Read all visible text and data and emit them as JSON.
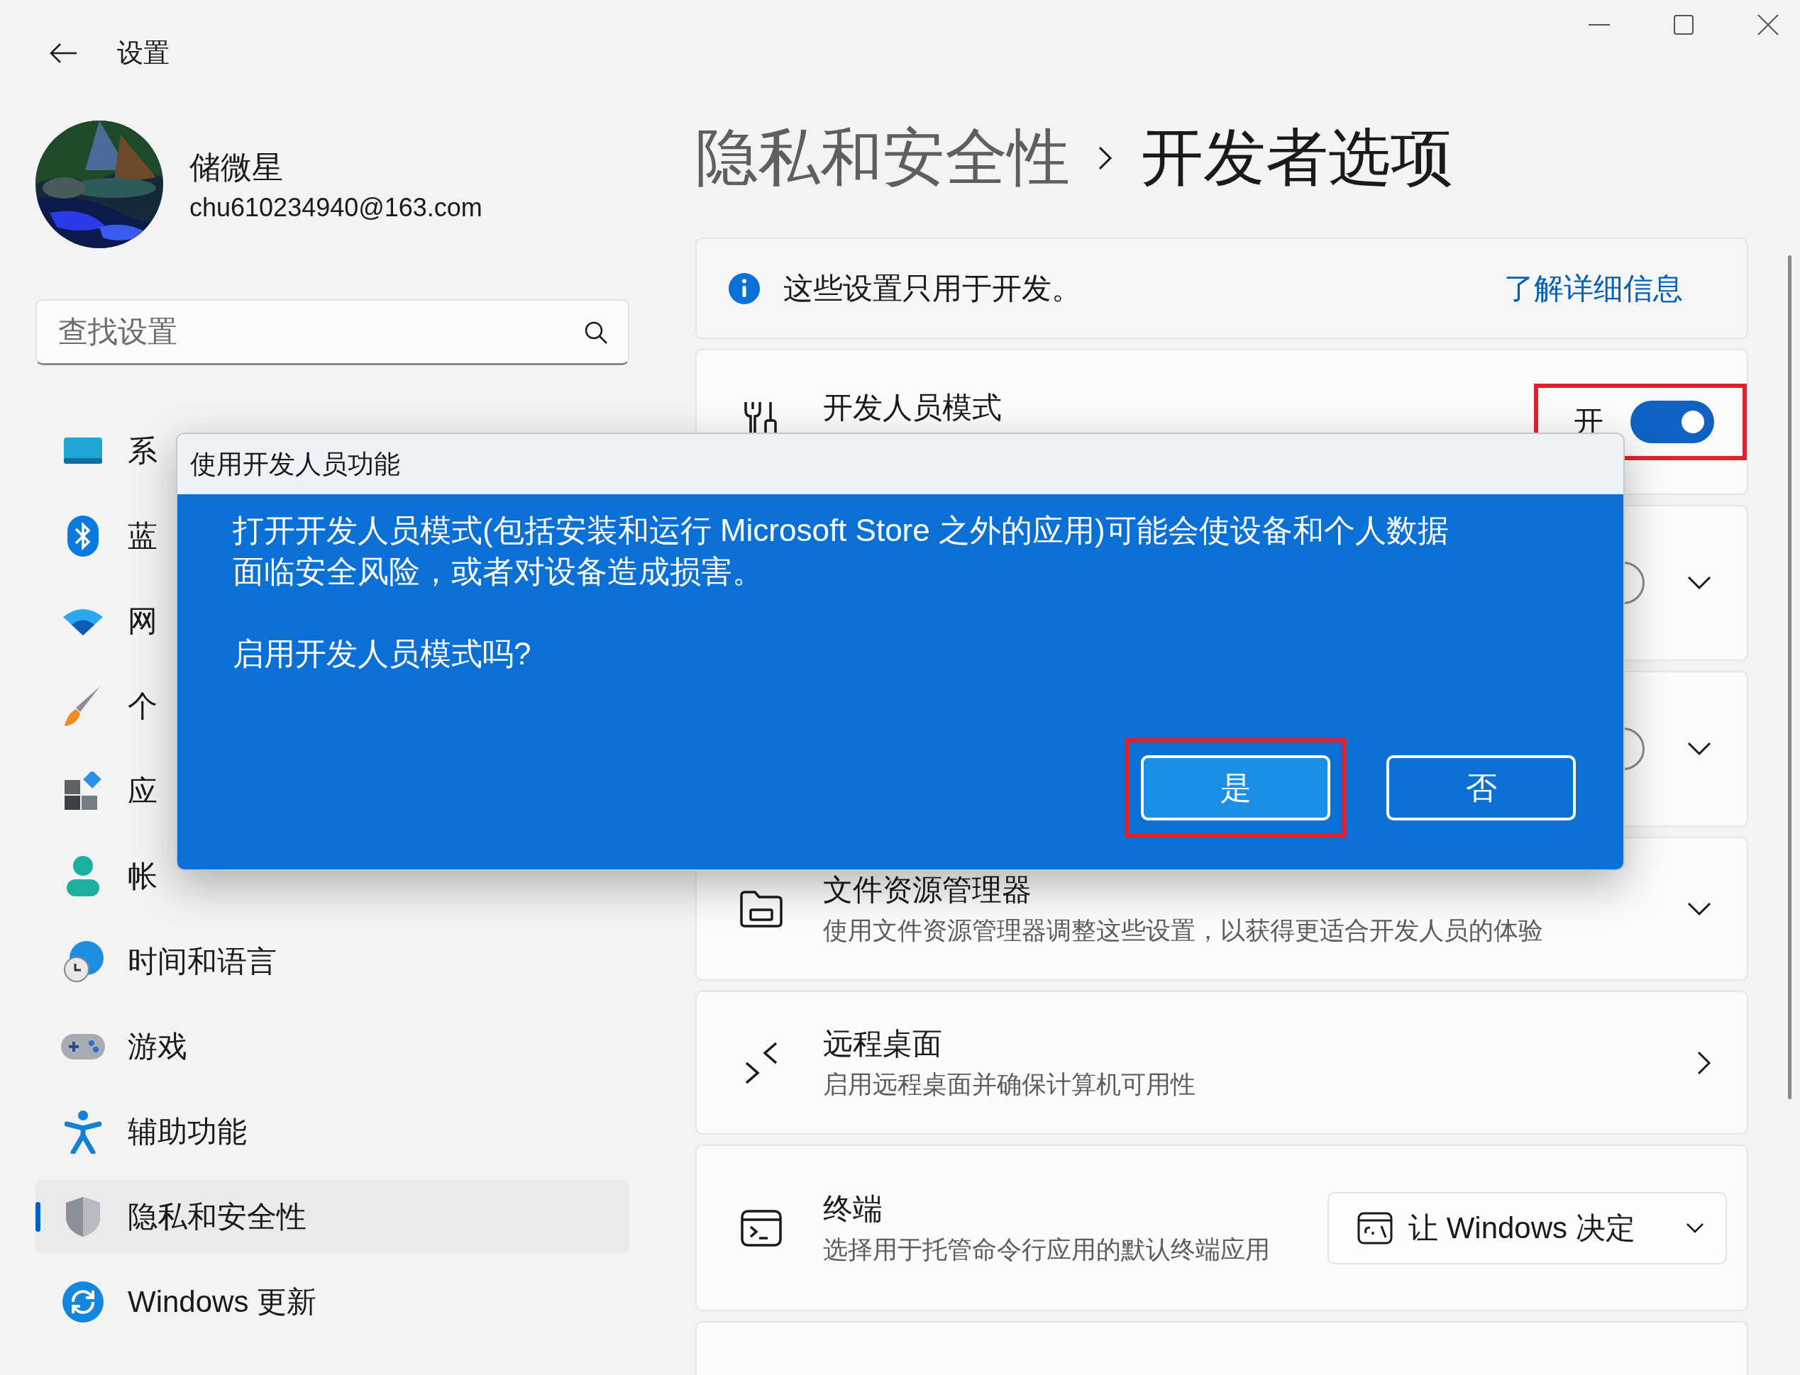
{
  "window": {
    "title": "设置"
  },
  "profile": {
    "name": "储微星",
    "email": "chu610234940@163.com"
  },
  "search": {
    "placeholder": "查找设置"
  },
  "nav": [
    {
      "label": "系",
      "selected": false
    },
    {
      "label": "蓝",
      "selected": false
    },
    {
      "label": "网",
      "selected": false
    },
    {
      "label": "个",
      "selected": false
    },
    {
      "label": "应",
      "selected": false
    },
    {
      "label": "帐",
      "selected": false
    },
    {
      "label": "时间和语言",
      "selected": false
    },
    {
      "label": "游戏",
      "selected": false
    },
    {
      "label": "辅助功能",
      "selected": false
    },
    {
      "label": "隐私和安全性",
      "selected": true
    },
    {
      "label": "Windows 更新",
      "selected": false
    }
  ],
  "breadcrumb": {
    "parent": "隐私和安全性",
    "current": "开发者选项"
  },
  "info": {
    "text": "这些设置只用于开发。",
    "link": "了解详细信息"
  },
  "cards": [
    {
      "kind": "toggle",
      "title": "开发人员模式",
      "state_label": "开",
      "on": true,
      "highlighted": true
    },
    {
      "kind": "toggle-expand",
      "on": false
    },
    {
      "kind": "toggle-expand",
      "on": false
    },
    {
      "kind": "expand",
      "title": "文件资源管理器",
      "subtitle": "使用文件资源管理器调整这些设置，以获得更适合开发人员的体验"
    },
    {
      "kind": "link",
      "title": "远程桌面",
      "subtitle": "启用远程桌面并确保计算机可用性"
    },
    {
      "kind": "dropdown",
      "title": "终端",
      "subtitle": "选择用于托管命令行应用的默认终端应用",
      "value": "让 Windows 决定"
    },
    {
      "kind": "partial"
    }
  ],
  "dialog": {
    "title": "使用开发人员功能",
    "message": "打开开发人员模式(包括安装和运行 Microsoft Store 之外的应用)可能会使设备和个人数据面临安全风险，或者对设备造成损害。",
    "question": "启用开发人员模式吗?",
    "buttons": [
      {
        "label": "是",
        "selected": true,
        "highlighted": true
      },
      {
        "label": "否",
        "selected": false,
        "highlighted": false
      }
    ]
  }
}
